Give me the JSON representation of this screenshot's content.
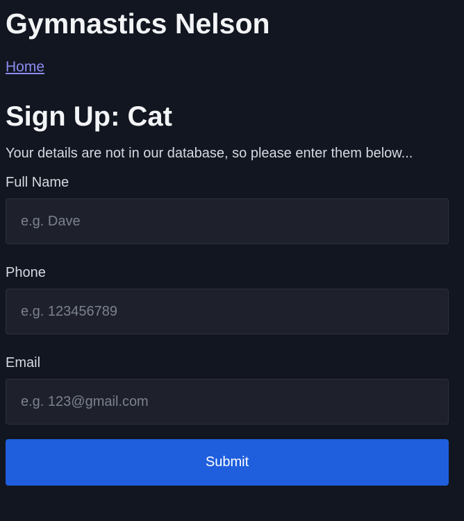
{
  "header": {
    "site_title": "Gymnastics Nelson"
  },
  "nav": {
    "home_label": "Home"
  },
  "main": {
    "heading": "Sign Up: Cat",
    "intro": "Your details are not in our database, so please enter them below...",
    "fields": [
      {
        "label": "Full Name",
        "placeholder": "e.g. Dave",
        "value": ""
      },
      {
        "label": "Phone",
        "placeholder": "e.g. 123456789",
        "value": ""
      },
      {
        "label": "Email",
        "placeholder": "e.g. 123@gmail.com",
        "value": ""
      }
    ],
    "submit_label": "Submit"
  },
  "colors": {
    "background": "#121620",
    "input_background": "#1e212b",
    "link": "#8b8cf0",
    "accent": "#1f5fde"
  }
}
